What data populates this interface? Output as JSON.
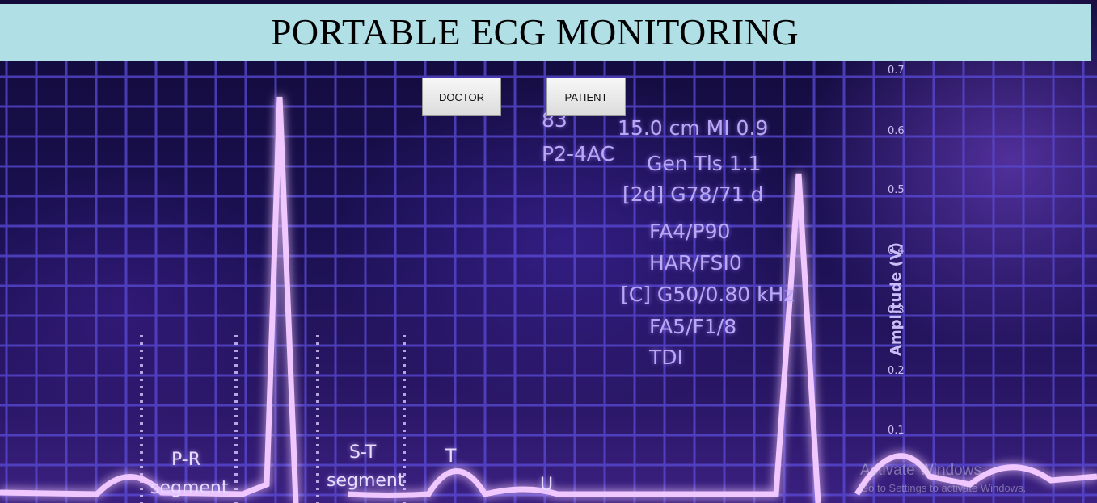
{
  "header": {
    "title": "PORTABLE ECG MONITORING"
  },
  "nav": {
    "doctor_label": "DOCTOR",
    "patient_label": "PATIENT"
  },
  "background": {
    "readouts": {
      "r0": "83",
      "r1": "15.0 cm MI 0.9",
      "r2": "P2-4AC",
      "r3": "Gen Tls 1.1",
      "r4": "[2d] G78/71 d",
      "r5": "FA4/P90",
      "r6": "HAR/FSI0",
      "r7": "[C] G50/0.80 kHz",
      "r8": "FA5/F1/8",
      "r9": "TDI"
    },
    "axis_title": "Amplitude (V)",
    "ticks": {
      "t0": "0.7",
      "t1": "0.6",
      "t2": "0.5",
      "t3": "0.4",
      "t4": "0.3",
      "t5": "0.2",
      "t6": "0.1"
    },
    "ecg_labels": {
      "pr": "P-R",
      "pr_seg": "segment",
      "st": "S-T",
      "st_seg": "segment",
      "t": "T",
      "u": "U"
    }
  },
  "watermark": {
    "title": "Activate Windows",
    "subtitle": "Go to Settings to activate Windows."
  },
  "colors": {
    "banner": "#b0dfe5",
    "grid": "#5a4bd8",
    "trace": "#f0c8ff"
  }
}
